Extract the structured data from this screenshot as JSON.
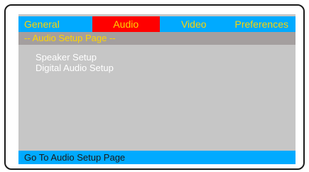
{
  "tabs": [
    {
      "label": "General",
      "active": false
    },
    {
      "label": "Audio",
      "active": true
    },
    {
      "label": "Video",
      "active": false
    },
    {
      "label": "Preferences",
      "active": false
    }
  ],
  "subheader": "-- Audio Setup Page --",
  "menu": {
    "items": [
      "Speaker Setup",
      "Digital Audio Setup"
    ]
  },
  "status": "Go To Audio Setup Page",
  "colors": {
    "tab_bg": "#00aaff",
    "tab_active_bg": "#ff0000",
    "tab_text": "#ffd400",
    "screen_bg": "#c6c6c6",
    "subheader_bg": "#a49f9f",
    "menu_text": "#ffffff",
    "status_bg": "#00aaff"
  }
}
